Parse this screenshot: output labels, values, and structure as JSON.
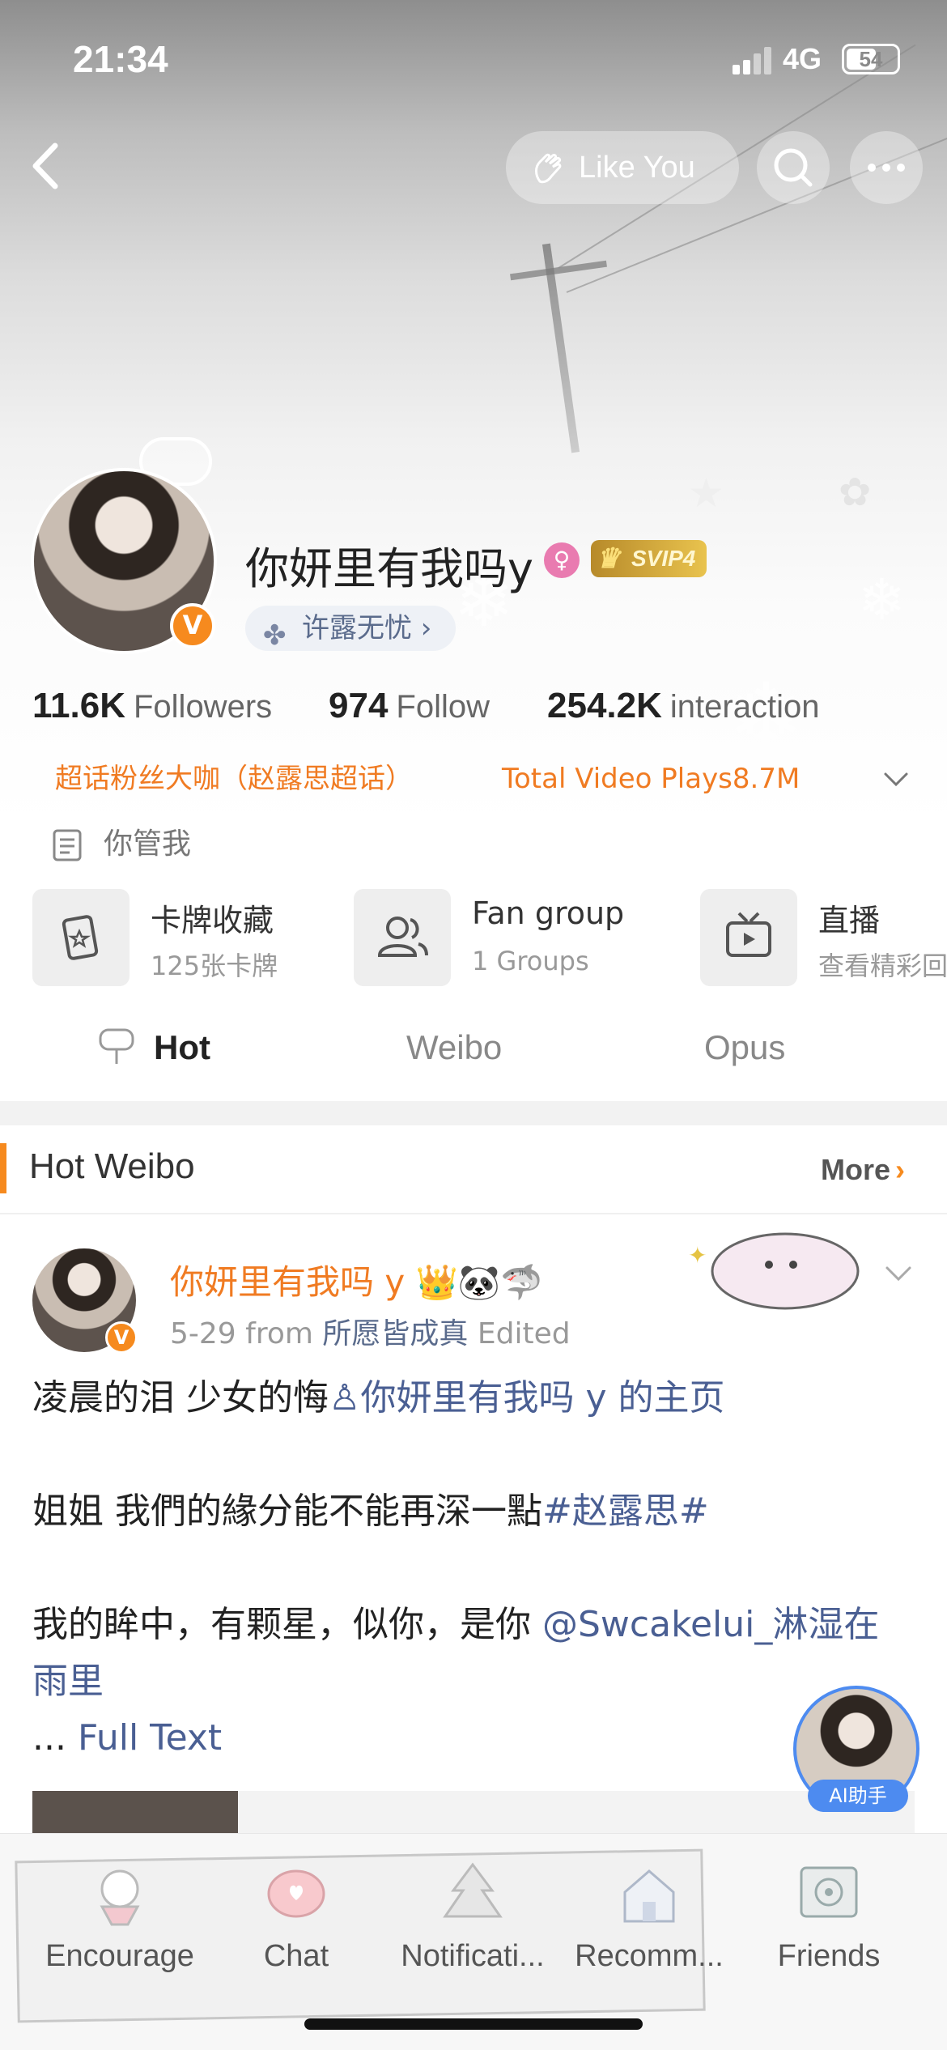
{
  "status_bar": {
    "time": "21:34",
    "network": "4G",
    "battery": "54"
  },
  "header": {
    "like_label": "Like You",
    "username": "你妍里有我吗y",
    "gender_icon": "♀",
    "vip_badge": "SVIP4",
    "tag_chip": "许露无忧 ›",
    "stats": [
      {
        "value": "11.6K",
        "label": "Followers"
      },
      {
        "value": "974",
        "label": "Follow"
      },
      {
        "value": "254.2K",
        "label": "interaction"
      }
    ],
    "honor": "超话粉丝大咖（赵露思超话）",
    "video_plays": "Total Video Plays8.7M",
    "bio": "你管我",
    "cards": [
      {
        "title": "卡牌收藏",
        "subtitle": "125张卡牌",
        "icon": "card-collection-icon"
      },
      {
        "title": "Fan group",
        "subtitle": "1 Groups",
        "icon": "fan-group-icon"
      },
      {
        "title": "直播",
        "subtitle": "查看精彩回",
        "icon": "live-tv-icon"
      }
    ],
    "tabs": [
      "Hot",
      "Weibo",
      "Opus"
    ],
    "active_tab": "Hot"
  },
  "hot_section": {
    "title": "Hot Weibo",
    "more": "More",
    "post": {
      "author": "你妍里有我吗 y 👑🐼🦈",
      "date": "5-29",
      "from_label": "from",
      "source": "所愿皆成真",
      "edited": "Edited",
      "line1": "凌晨的泪 少女的悔",
      "line1_link": "你妍里有我吗 y 的主页",
      "line2": "姐姐 我們的緣分能不能再深一點",
      "line2_tag": "#赵露思#",
      "line3": "我的眸中，有颗星，似你，是你 ",
      "line3_mention": "@Swcakelui_淋湿在雨里",
      "ellipsis": "... ",
      "full_text": "Full Text"
    }
  },
  "ai_assistant": {
    "label": "AI助手"
  },
  "bottom_nav": [
    {
      "label": "Encourage",
      "icon": "encourage-icon"
    },
    {
      "label": "Chat",
      "icon": "chat-icon"
    },
    {
      "label": "Notificati...",
      "icon": "notification-icon"
    },
    {
      "label": "Recomm...",
      "icon": "recommend-icon"
    },
    {
      "label": "Friends",
      "icon": "friends-icon"
    }
  ],
  "colors": {
    "accent": "#f68a1e",
    "link": "#4a5f93",
    "honor": "#f07b22"
  }
}
